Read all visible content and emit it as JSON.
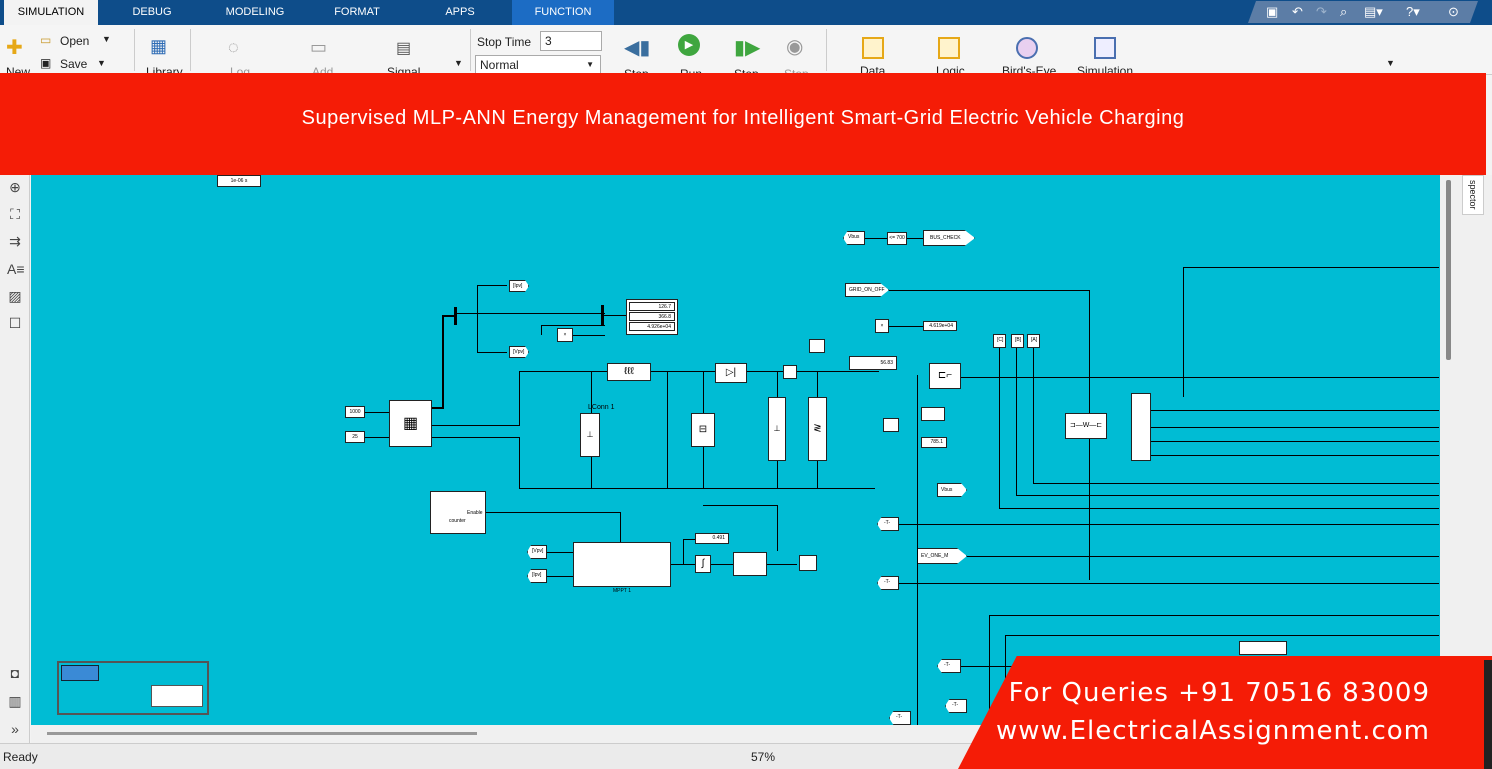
{
  "tabs": [
    "SIMULATION",
    "DEBUG",
    "MODELING",
    "FORMAT",
    "APPS",
    "FUNCTION"
  ],
  "toolstrip": {
    "new": "New",
    "open": "Open",
    "save": "Save",
    "library": "Library",
    "log": "Log",
    "add": "Add",
    "signal": "Signal",
    "stop_time_label": "Stop Time",
    "stop_time_value": "3",
    "mode": "Normal",
    "step_back": "Step",
    "run": "Run",
    "step_fwd": "Step",
    "stop": "Stop",
    "data": "Data",
    "logic": "Logic",
    "birds_eye": "Bird's-Eye",
    "simulation": "Simulation"
  },
  "banner_title": "Supervised MLP-ANN Energy Management for Intelligent Smart-Grid Electric Vehicle Charging",
  "right_tab": "spector",
  "status": {
    "left": "Ready",
    "zoom": "57%"
  },
  "promo": {
    "line1": "For Queries +91 70516 83009",
    "line2": "www.ElectricalAssignment.com"
  },
  "diagram": {
    "sample_time": "1e-06 s",
    "irr": "1000",
    "temp": "25",
    "tag_ipv": "[Ipv]",
    "tag_vpv": "[Vpv]",
    "disp_values": [
      "126.7",
      "366.8",
      "4.926e+04"
    ],
    "vbus_tag": "Vbus",
    "compare": "<= 700",
    "bus_check": "BUS_CHECK",
    "grid_on_off": "GRID_ON_OFF",
    "power_disp": "4.619e+04",
    "disp_5683": "56.83",
    "disp_7851": "785.1",
    "lconn": "LConn 1",
    "vbus2": "Vbus",
    "ev_one": "EV_ONE_M",
    "enable": "Enable",
    "counter": "counter",
    "mppt": "MPPT 1",
    "duty": "0.491",
    "goto_c": "[C]",
    "goto_b": "[B]",
    "goto_a": "[A]",
    "from_t": "-T-"
  }
}
